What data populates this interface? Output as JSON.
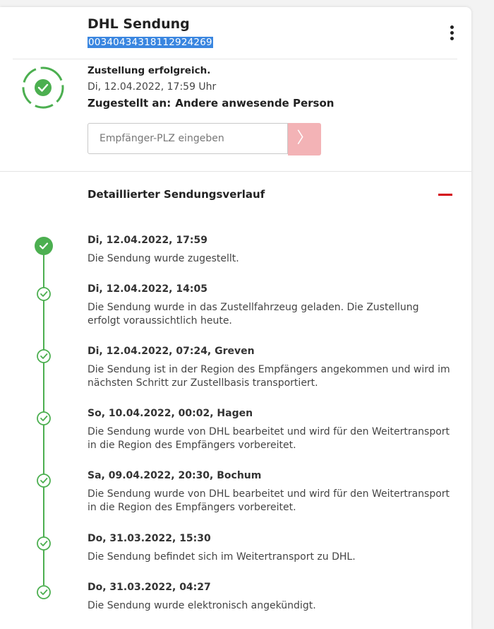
{
  "header": {
    "title": "DHL Sendung",
    "tracking_number": "00340434318112924269"
  },
  "status": {
    "headline": "Zustellung erfolgreich.",
    "date": "Di, 12.04.2022, 17:59 Uhr",
    "delivered_to_label": "Zugestellt an:",
    "delivered_to_value": "Andere anwesende Person"
  },
  "plz": {
    "placeholder": "Empfänger-PLZ eingeben",
    "button_icon": "chevron-right-icon"
  },
  "history": {
    "title": "Detaillierter Sendungsverlauf",
    "collapse_icon": "minus-icon",
    "events": [
      {
        "date": "Di, 12.04.2022, 17:59",
        "text": "Die Sendung wurde zugestellt."
      },
      {
        "date": "Di, 12.04.2022, 14:05",
        "text": "Die Sendung wurde in das Zustellfahrzeug geladen. Die Zustellung erfolgt voraussichtlich heute."
      },
      {
        "date": "Di, 12.04.2022, 07:24, Greven",
        "text": "Die Sendung ist in der Region des Empfängers angekommen und wird im nächsten Schritt zur Zustellbasis transportiert."
      },
      {
        "date": "So, 10.04.2022, 00:02, Hagen",
        "text": "Die Sendung wurde von DHL bearbeitet und wird für den Weitertransport in die Region des Empfängers vorbereitet."
      },
      {
        "date": "Sa, 09.04.2022, 20:30, Bochum",
        "text": "Die Sendung wurde von DHL bearbeitet und wird für den Weitertransport in die Region des Empfängers vorbereitet."
      },
      {
        "date": "Do, 31.03.2022, 15:30",
        "text": "Die Sendung befindet sich im Weitertransport zu DHL."
      },
      {
        "date": "Do, 31.03.2022, 04:27",
        "text": "Die Sendung wurde elektronisch angekündigt."
      }
    ]
  },
  "colors": {
    "success": "#4caf50",
    "accent": "#d40511",
    "button_disabled": "#f3b3b6",
    "selection": "#3a86e0"
  }
}
